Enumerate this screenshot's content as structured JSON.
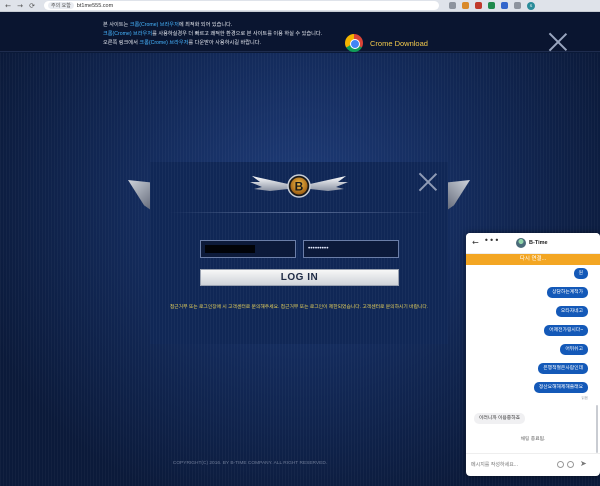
{
  "browser": {
    "back": "←",
    "forward": "→",
    "reload": "⟳",
    "secure_label": "주의 요함",
    "url": "bt1me555.com",
    "avatar_letter": "S"
  },
  "notice": {
    "line1_pre": "본 사이트는 ",
    "line1_hl": "크롬(Crome) 브라우저",
    "line1_post": "에 최적화 되어 있습니다.",
    "line2_hl": "크롬(Crome) 브라우저",
    "line2_post": "를 사용하실경우 더 빠르고 쾌적한 환경으로 본 사이트를 이용 하실 수 있습니다.",
    "line3_pre": "오른쪽 링크에서 ",
    "line3_hl": "크롬(Crome) 브라우저",
    "line3_post": "를 다운받아 사용하시길 바랍니다.",
    "download_label": "Crome Download"
  },
  "login": {
    "logo_letter": "B",
    "id_value": "",
    "password_value": "•••••••••",
    "button_label": "LOG IN",
    "help_text": "접근거부 또는 로그인장애 시 고객센터로 문의해주세요. 접근거부 또는 로그인이 제한되었습니다. 고객센터로 문의하시기 바랍니다."
  },
  "copyright": "COPYRIGHT(C) 2016. BY B-TIME COMPANY. ALL RIGHT RESERVED.",
  "chat": {
    "name": "B-Time",
    "banner": "다시 연결...",
    "outgoing": [
      "원",
      "상담하는계적가",
      "오타자네고",
      "어제전가링시다~",
      "어뒤쉬고",
      "은행적절은사람인데",
      "정산요해해제해줄래요"
    ],
    "time_label": "읽음",
    "incoming": "이러니까 이용중하죠",
    "ended": "채팅 종료됨.",
    "input_placeholder": "메시지를 작성하세요..."
  },
  "colors": {
    "accent_blue": "#1459b8",
    "banner_orange": "#f3a623",
    "download_yellow": "#f2c94c",
    "link_blue": "#46b5ff"
  }
}
